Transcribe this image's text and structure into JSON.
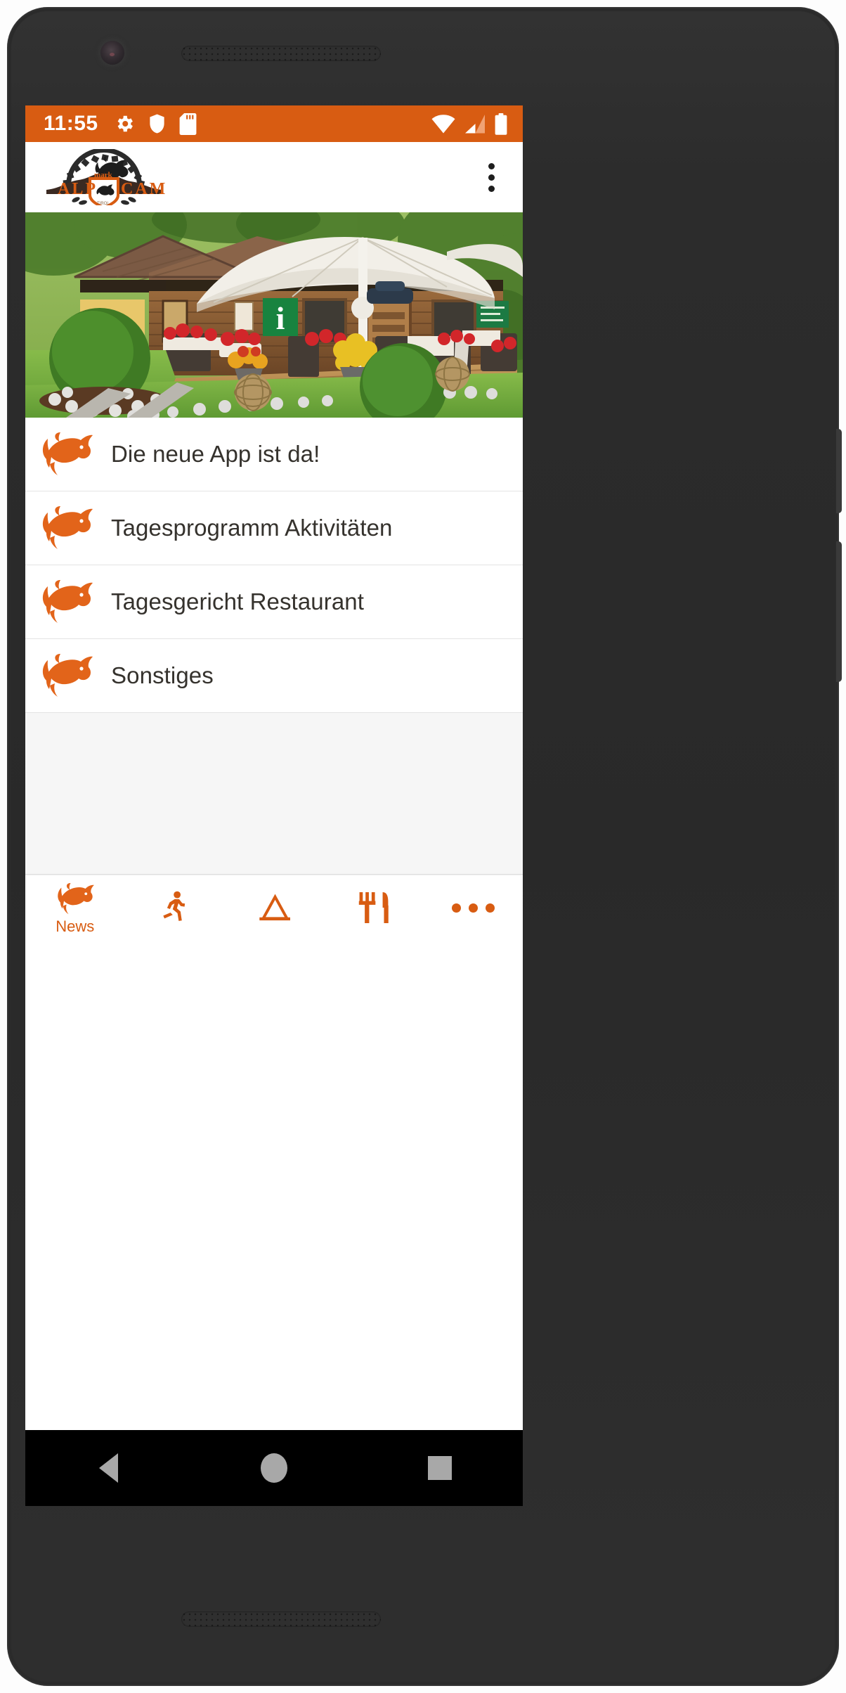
{
  "device": {
    "platform": "android-phone",
    "camera_icon": "front-camera",
    "earpiece_icon": "earpiece-speaker"
  },
  "statusbar": {
    "time": "11:55",
    "left_icons": [
      "gear-icon",
      "shield-icon",
      "sd-card-icon"
    ],
    "right_icons": [
      "wifi-icon",
      "cellular-signal-icon",
      "battery-icon"
    ],
    "background": "#d85c12",
    "foreground": "#ffffff"
  },
  "appbar": {
    "logo_alt": "ALP CAMP",
    "logo_text_left": "ALP",
    "logo_text_right": "CAMP",
    "logo_badge_text": "mark",
    "logo_sub_text": "TIROL",
    "overflow_icon": "more-vertical-icon"
  },
  "hero": {
    "alt": "Alp Camp reception chalet with terrace, white parasol and flower beds",
    "info_sign": "i"
  },
  "news": {
    "items": [
      {
        "label": "Die neue App ist da!",
        "icon": "horse-head-icon"
      },
      {
        "label": "Tagesprogramm Aktivitäten",
        "icon": "horse-head-icon"
      },
      {
        "label": "Tagesgericht Restaurant",
        "icon": "horse-head-icon"
      },
      {
        "label": "Sonstiges",
        "icon": "horse-head-icon"
      }
    ]
  },
  "tabbar": {
    "active_color": "#d85c12",
    "tabs": [
      {
        "label": "News",
        "icon": "horse-head-icon",
        "active": true
      },
      {
        "label": "",
        "icon": "running-person-icon",
        "active": false
      },
      {
        "label": "",
        "icon": "tent-camping-icon",
        "active": false
      },
      {
        "label": "",
        "icon": "fork-knife-icon",
        "active": false
      },
      {
        "label": "",
        "icon": "more-horizontal-icon",
        "active": false
      }
    ]
  },
  "androidnav": {
    "buttons": [
      "back-triangle-icon",
      "home-circle-icon",
      "recents-square-icon"
    ]
  },
  "theme": {
    "accent": "#d85c12",
    "text": "#35322d",
    "divider": "#e4e4e4",
    "filler_bg": "#f6f6f6"
  }
}
